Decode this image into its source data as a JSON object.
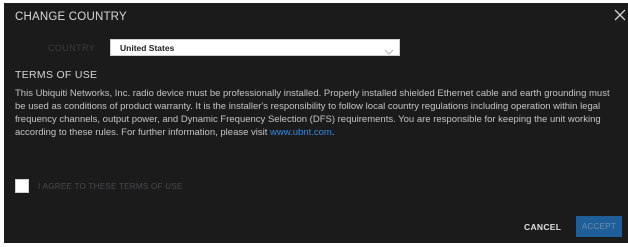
{
  "dialog": {
    "title": "CHANGE COUNTRY",
    "close_icon": "close-icon"
  },
  "country": {
    "label": "COUNTRY",
    "selected": "United States",
    "chevron_icon": "chevron-down-icon"
  },
  "terms": {
    "heading": "TERMS OF USE",
    "body": "This Ubiquiti Networks, Inc. radio device must be professionally installed. Properly installed shielded Ethernet cable and earth grounding must be used as conditions of product warranty. It is the installer's responsibility to follow local country regulations including operation within legal frequency channels, output power, and Dynamic Frequency Selection (DFS) requirements. You are responsible for keeping the unit working according to these rules. For further information, please visit ",
    "link_text": "www.ubnt.com",
    "suffix": ".",
    "agree_label": "I AGREE TO THESE TERMS OF USE",
    "agree_checked": false
  },
  "actions": {
    "cancel_label": "CANCEL",
    "accept_label": "ACCEPT",
    "accept_enabled": false
  },
  "colors": {
    "dialog_background": "#1b1b1c",
    "link": "#2e8ae6",
    "accept_button": "#1f5f99"
  }
}
